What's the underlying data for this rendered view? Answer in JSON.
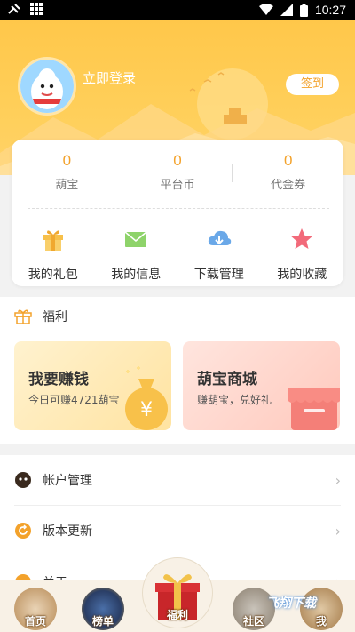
{
  "status_bar": {
    "time": "10:27"
  },
  "header": {
    "login_text": "立即登录",
    "checkin_label": "签到"
  },
  "stats": [
    {
      "value": "0",
      "label": "葫宝"
    },
    {
      "value": "0",
      "label": "平台币"
    },
    {
      "value": "0",
      "label": "代金券"
    }
  ],
  "quick_links": [
    {
      "label": "我的礼包",
      "icon": "gift-icon",
      "color": "#f7c04a"
    },
    {
      "label": "我的信息",
      "icon": "mail-icon",
      "color": "#8ed36a"
    },
    {
      "label": "下载管理",
      "icon": "cloud-download-icon",
      "color": "#6aa8e8"
    },
    {
      "label": "我的收藏",
      "icon": "star-icon",
      "color": "#f26a7a"
    }
  ],
  "welfare": {
    "title": "福利",
    "earn": {
      "title": "我要赚钱",
      "subtitle": "今日可赚4721葫宝"
    },
    "shop": {
      "title": "葫宝商城",
      "subtitle": "赚葫宝，兑好礼"
    }
  },
  "menu": [
    {
      "label": "帐户管理",
      "icon": "account-icon"
    },
    {
      "label": "版本更新",
      "icon": "update-icon"
    },
    {
      "label": "关于",
      "icon": "about-icon"
    }
  ],
  "bottom_nav": [
    {
      "label": "首页"
    },
    {
      "label": "榜单"
    },
    {
      "label": "福利"
    },
    {
      "label": "社区"
    },
    {
      "label": "我"
    }
  ],
  "watermark": "飞翔下载",
  "colors": {
    "accent": "#f3a22b",
    "header": "#ffc74a"
  }
}
